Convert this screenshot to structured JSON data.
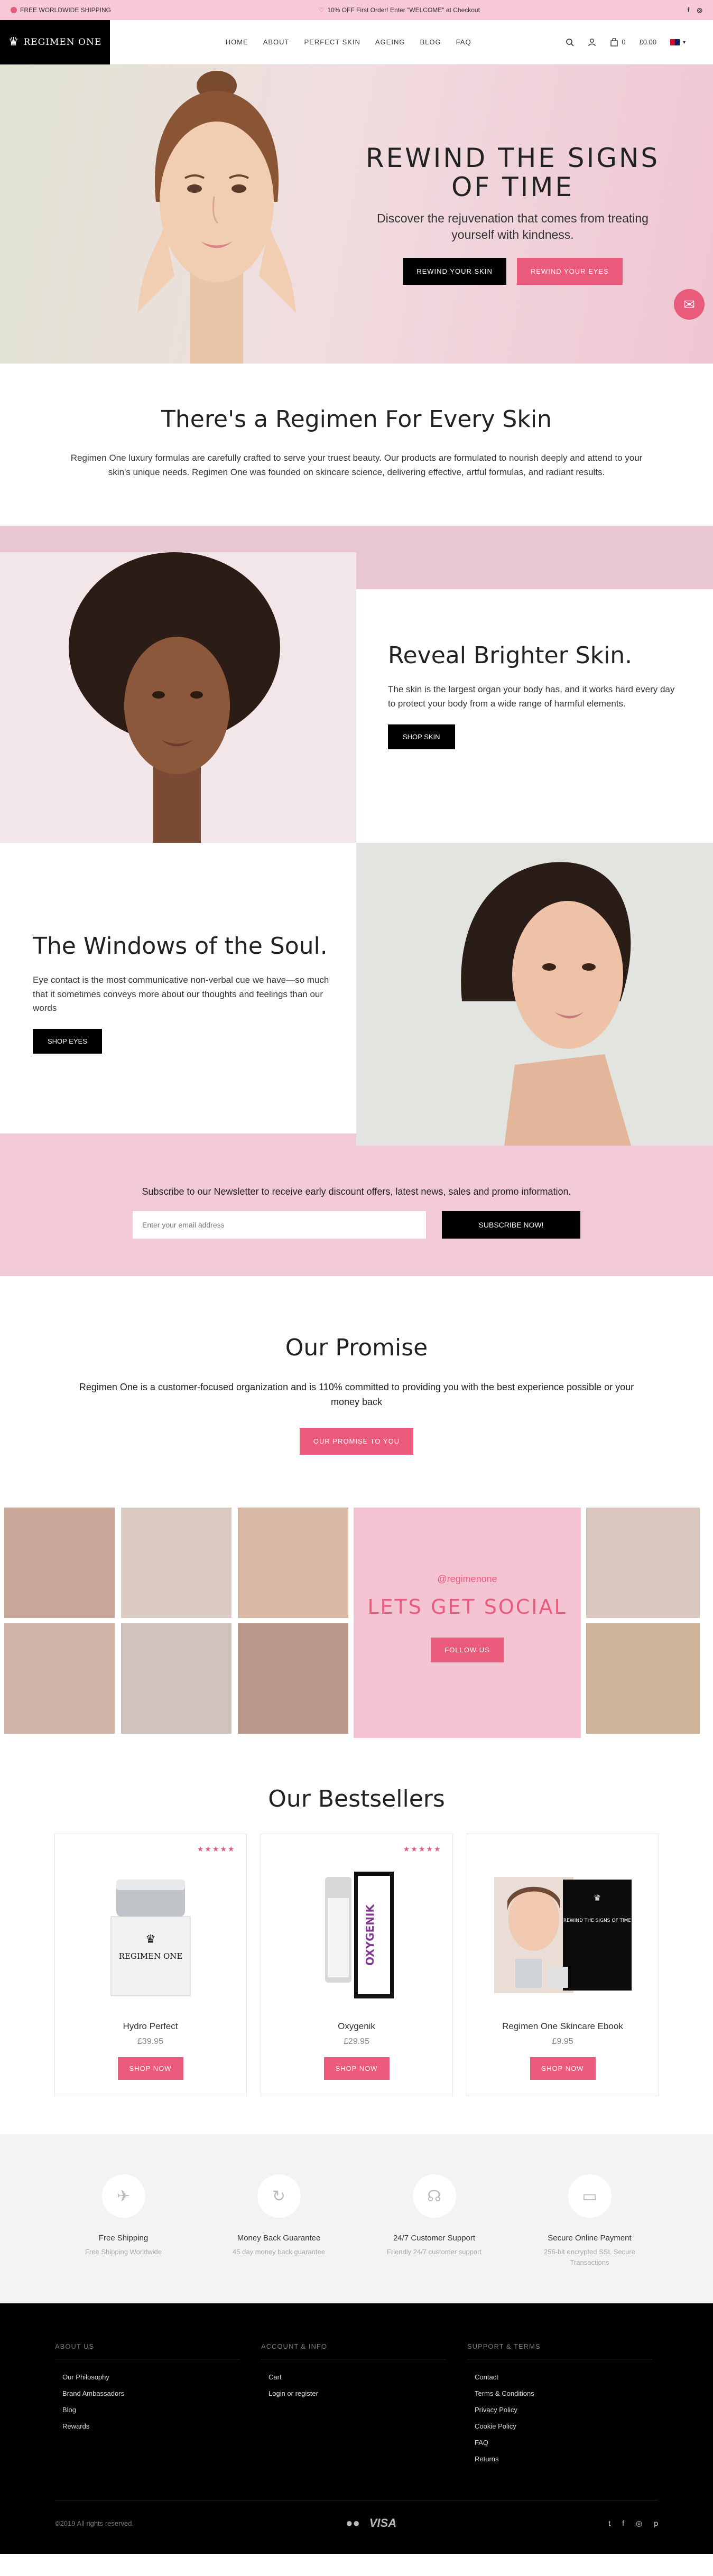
{
  "topbar": {
    "shipping": "FREE WORLDWIDE SHIPPING",
    "promo": "10% OFF First Order! Enter \"WELCOME\" at Checkout",
    "social": [
      "f",
      "◎"
    ]
  },
  "header": {
    "logo": "REGIMEN ONE",
    "nav": [
      "HOME",
      "ABOUT",
      "PERFECT SKIN",
      "AGEING",
      "BLOG",
      "FAQ"
    ],
    "cart_count": "0",
    "cart_total": "£0.00"
  },
  "hero": {
    "title": "REWIND THE SIGNS OF TIME",
    "subtitle": "Discover the rejuvenation that comes from treating yourself with kindness.",
    "btn1": "REWIND YOUR SKIN",
    "btn2": "REWIND YOUR EYES"
  },
  "intro": {
    "title": "There's a Regimen For Every Skin",
    "body": "Regimen One luxury formulas are carefully crafted to serve your truest beauty. Our products are formulated to nourish deeply and attend to your skin's unique needs. Regimen One was founded on skincare science, delivering effective, artful formulas, and radiant results."
  },
  "feature1": {
    "title": "Reveal Brighter Skin.",
    "body": "The skin is the largest organ your body has, and it works hard every day to protect your body from a wide range of harmful elements.",
    "button": "SHOP SKIN"
  },
  "feature2": {
    "title": "The Windows of the Soul.",
    "body": "Eye contact is the most communicative non-verbal cue we have—so much that it sometimes conveys more about our thoughts and feelings than our words",
    "button": "SHOP EYES"
  },
  "newsletter": {
    "text": "Subscribe to our Newsletter to receive early discount offers, latest news, sales and promo information.",
    "placeholder": "Enter your email address",
    "button": "SUBSCRIBE NOW!"
  },
  "promise": {
    "title": "Our Promise",
    "body": "Regimen One is a customer-focused organization and is 110% committed to providing you with the best experience possible or your money back",
    "button": "OUR PROMISE TO YOU"
  },
  "social": {
    "handle": "@regimenone",
    "title": "LETS GET SOCIAL",
    "button": "FOLLOW US"
  },
  "bestsellers": {
    "title": "Our Bestsellers",
    "button": "SHOP NOW",
    "stars": "★★★★★",
    "products": [
      {
        "name": "Hydro Perfect",
        "price": "£39.95",
        "label": "REGIMEN ONE"
      },
      {
        "name": "Oxygenik",
        "price": "£29.95",
        "label": "OXYGENIK"
      },
      {
        "name": "Regimen One Skincare Ebook",
        "price": "£9.95",
        "label": "REWIND THE SIGNS OF TIME"
      }
    ]
  },
  "perks": [
    {
      "title": "Free Shipping",
      "sub": "Free Shipping Worldwide",
      "icon": "plane-icon"
    },
    {
      "title": "Money Back Guarantee",
      "sub": "45 day money back guarantee",
      "icon": "refresh-icon"
    },
    {
      "title": "24/7 Customer Support",
      "sub": "Friendly 24/7 customer support",
      "icon": "headset-icon"
    },
    {
      "title": "Secure Online Payment",
      "sub": "256-bit encrypted SSL Secure Transactions",
      "icon": "card-icon"
    }
  ],
  "footer": {
    "col1_head": "ABOUT US",
    "col1_links": [
      "Our Philosophy",
      "Brand Ambassadors",
      "Blog",
      "Rewards"
    ],
    "col2_head": "ACCOUNT & INFO",
    "col2_links": [
      "Cart",
      "Login or register"
    ],
    "col3_head": "SUPPORT & TERMS",
    "col3_links": [
      "Contact",
      "Terms & Conditions",
      "Privacy Policy",
      "Cookie Policy",
      "FAQ",
      "Returns"
    ],
    "copyright": "©2019 All rights reserved.",
    "visa": "VISA",
    "social": [
      "t",
      "f",
      "◎",
      "p"
    ]
  },
  "colors": {
    "pink": "#ea5a7b",
    "light_pink": "#f2c9d6",
    "black": "#000000"
  }
}
